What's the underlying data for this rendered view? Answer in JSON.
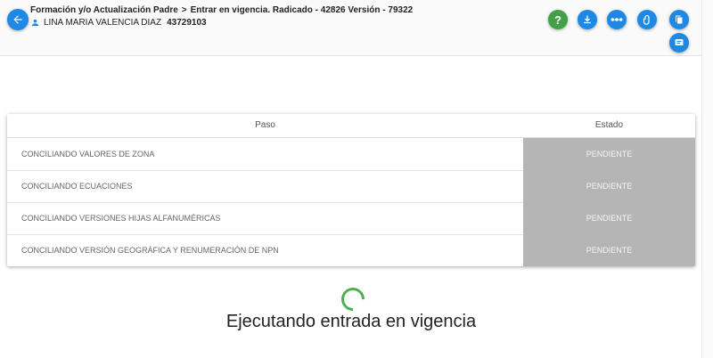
{
  "header": {
    "title_parent": "Formación y/o Actualización Padre",
    "breadcrumb_separator": ">",
    "title_action": "Entrar en vigencia. Radicado - 42826 Versión - 79322",
    "user_name": "LINA MARIA VALENCIA DIAZ",
    "user_id": "43729103",
    "help_label": "?"
  },
  "table": {
    "columns": [
      "Paso",
      "Estado"
    ],
    "rows": [
      {
        "step": "CONCILIANDO VALORES DE ZONA",
        "status": "PENDIENTE"
      },
      {
        "step": "CONCILIANDO ECUACIONES",
        "status": "PENDIENTE"
      },
      {
        "step": "CONCILIANDO VERSIONES HIJAS ALFANUMÉRICAS",
        "status": "PENDIENTE"
      },
      {
        "step": "CONCILIANDO VERSIÓN GEOGRÁFICA Y RENUMERACIÓN DE NPN",
        "status": "PENDIENTE"
      }
    ]
  },
  "status_message": "Ejecutando entrada en vigencia",
  "colors": {
    "primary": "#1e88e5",
    "help": "#43a047",
    "spinner": "#4caf50",
    "pending_bg": "#b5b5b5"
  },
  "icons": [
    "arrow-left-icon",
    "person-icon",
    "help-icon",
    "download-icon",
    "more-horizontal-icon",
    "paperclip-icon",
    "copy-icon",
    "notes-icon"
  ]
}
